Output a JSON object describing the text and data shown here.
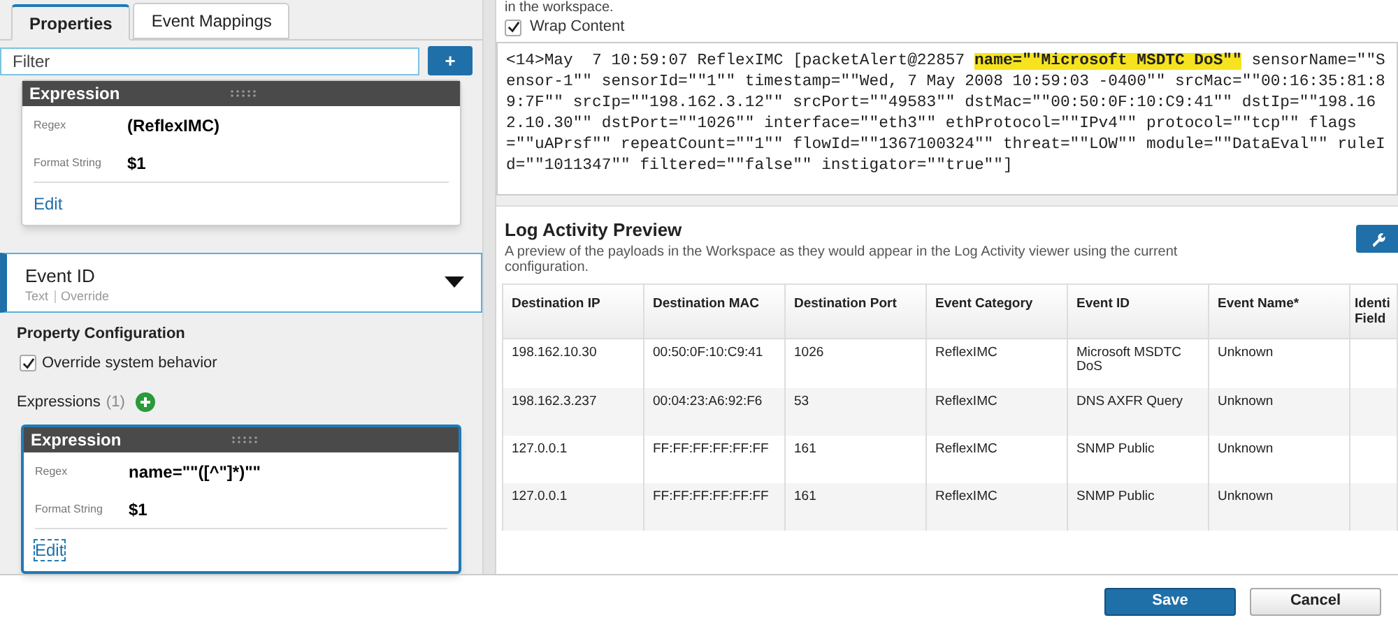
{
  "tabs": [
    {
      "label": "Properties",
      "selected": true
    },
    {
      "label": "Event Mappings",
      "selected": false
    }
  ],
  "filter": {
    "placeholder": "Filter"
  },
  "add_button": "+",
  "top_expression": {
    "title": "Expression",
    "fields": [
      {
        "label": "Regex",
        "value": "(ReflexIMC)"
      },
      {
        "label": "Format String",
        "value": "$1"
      }
    ],
    "edit": "Edit"
  },
  "property": {
    "name": "Event ID",
    "type": "Text",
    "override": "Override",
    "expanded": true
  },
  "property_configuration": {
    "title": "Property Configuration",
    "override_label": "Override system behavior",
    "override_checked": true,
    "expressions_label": "Expressions",
    "expressions_count": "(1)"
  },
  "expression": {
    "title": "Expression",
    "fields": [
      {
        "label": "Regex",
        "value": "name=\"\"([^\"]*)\"\""
      },
      {
        "label": "Format String",
        "value": "$1"
      }
    ],
    "edit": "Edit"
  },
  "workspace": {
    "note": "in the workspace.",
    "wrap_label": "Wrap Content",
    "wrap_checked": true
  },
  "log": {
    "before": "<14>May  7 10:59:07 ReflexIMC [packetAlert@22857 ",
    "highlight": "name=\"\"Microsoft MSDTC DoS\"\"",
    "after": " sensorName=\"\"Sensor-1\"\" sensorId=\"\"1\"\" timestamp=\"\"Wed, 7 May 2008 10:59:03 -0400\"\" srcMac=\"\"00:16:35:81:89:7F\"\" srcIp=\"\"198.162.3.12\"\" srcPort=\"\"49583\"\" dstMac=\"\"00:50:0F:10:C9:41\"\" dstIp=\"\"198.162.10.30\"\" dstPort=\"\"1026\"\" interface=\"\"eth3\"\" ethProtocol=\"\"IPv4\"\" protocol=\"\"tcp\"\" flags=\"\"uAPrsf\"\" repeatCount=\"\"1\"\" flowId=\"\"1367100324\"\" threat=\"\"LOW\"\" module=\"\"DataEval\"\" ruleId=\"\"1011347\"\" filtered=\"\"false\"\" instigator=\"\"true\"\"]"
  },
  "preview": {
    "title": "Log Activity Preview",
    "description": "A preview of the payloads in the Workspace as they would appear in the Log Activity viewer using the current configuration."
  },
  "table": {
    "columns": [
      "Destination IP",
      "Destination MAC",
      "Destination Port",
      "Event Category",
      "Event ID",
      "Event Name*",
      "Identi Field"
    ],
    "rows": [
      [
        "198.162.10.30",
        "00:50:0F:10:C9:41",
        "1026",
        "ReflexIMC",
        "Microsoft MSDTC DoS",
        "Unknown"
      ],
      [
        "198.162.3.237",
        "00:04:23:A6:92:F6",
        "53",
        "ReflexIMC",
        "DNS AXFR Query",
        "Unknown"
      ],
      [
        "127.0.0.1",
        "FF:FF:FF:FF:FF:FF",
        "161",
        "ReflexIMC",
        "SNMP Public",
        "Unknown"
      ],
      [
        "127.0.0.1",
        "FF:FF:FF:FF:FF:FF",
        "161",
        "ReflexIMC",
        "SNMP Public",
        "Unknown"
      ]
    ]
  },
  "buttons": [
    {
      "label": "Save",
      "kind": "primary"
    },
    {
      "label": "Cancel",
      "kind": "secondary"
    }
  ]
}
